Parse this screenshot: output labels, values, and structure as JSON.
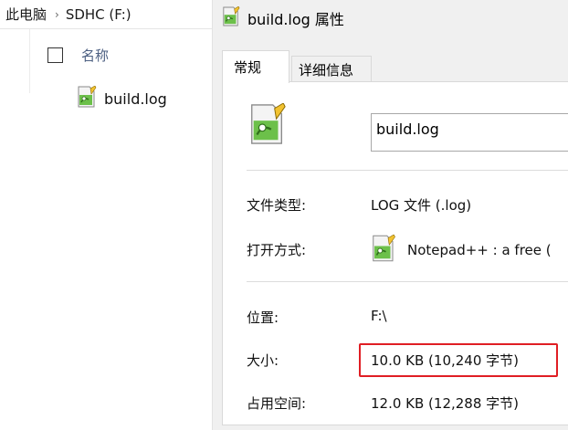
{
  "explorer": {
    "breadcrumb": [
      "此电脑",
      "SDHC (F:)"
    ],
    "column_name": "名称",
    "files": [
      {
        "name": "build.log",
        "icon": "notepadpp-file-icon"
      }
    ]
  },
  "dialog": {
    "title": "build.log 属性",
    "tabs": [
      {
        "label": "常规",
        "active": true
      },
      {
        "label": "详细信息",
        "active": false
      }
    ],
    "file_name": "build.log",
    "properties": {
      "type_label": "文件类型:",
      "type_value": "LOG 文件 (.log)",
      "opens_label": "打开方式:",
      "opens_value": "Notepad++ : a free (",
      "location_label": "位置:",
      "location_value": "F:\\",
      "size_label": "大小:",
      "size_value": "10.0 KB (10,240 字节)",
      "disk_label": "占用空间:",
      "disk_value": "12.0 KB (12,288 字节)"
    },
    "highlight_color": "#e01e24"
  }
}
